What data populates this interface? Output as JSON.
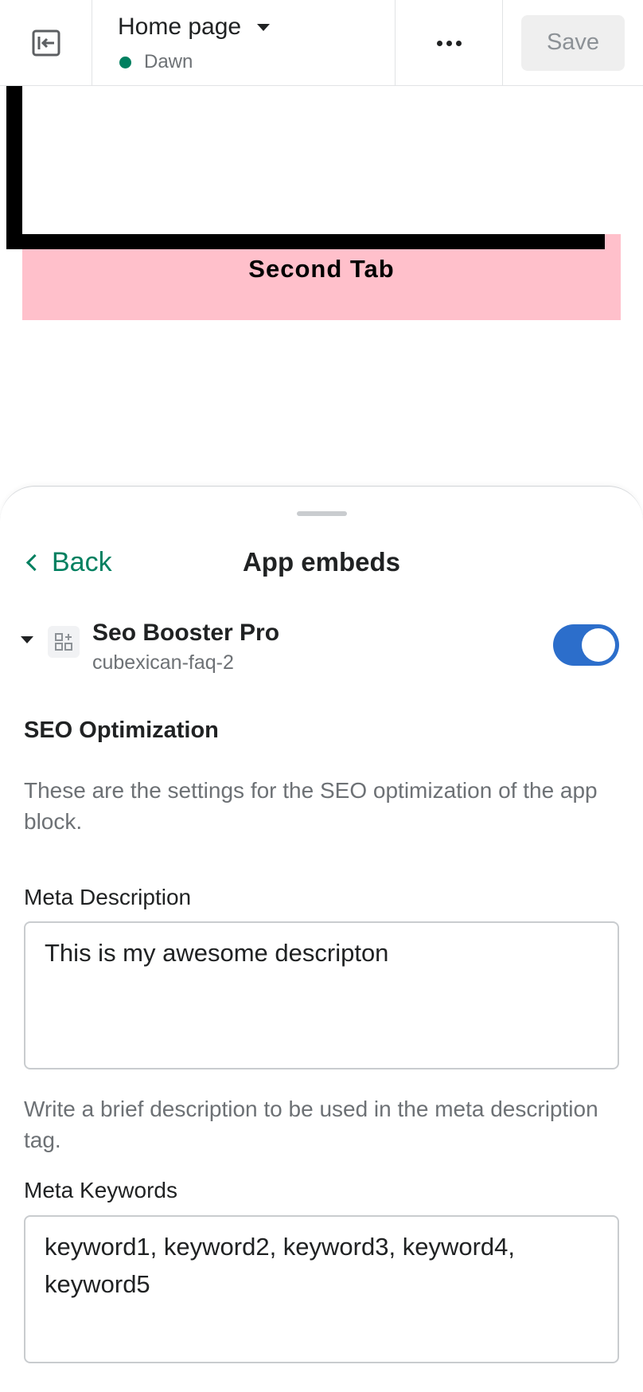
{
  "topbar": {
    "exit_icon": "exit-icon",
    "page_title": "Home page",
    "theme_name": "Dawn",
    "theme_status_color": "#008060",
    "more_icon": "more-horizontal-icon",
    "save_label": "Save"
  },
  "preview": {
    "tab_label": "Second Tab",
    "tab_background": "#ffc0cb"
  },
  "sheet": {
    "back_label": "Back",
    "title": "App embeds",
    "app": {
      "name": "Seo Booster Pro",
      "handle": "cubexican-faq-2",
      "enabled": true,
      "icon": "app-block-icon"
    },
    "section": {
      "title": "SEO Optimization",
      "description": "These are the settings for the SEO optimization of the app block."
    },
    "fields": [
      {
        "label": "Meta Description",
        "value": "This is my awesome descripton",
        "help": "Write a brief description to be used in the meta description tag."
      },
      {
        "label": "Meta Keywords",
        "value": "keyword1, keyword2, keyword3, keyword4, keyword5"
      }
    ]
  },
  "colors": {
    "accent_green": "#008060",
    "toggle_blue": "#2c6ecb"
  }
}
